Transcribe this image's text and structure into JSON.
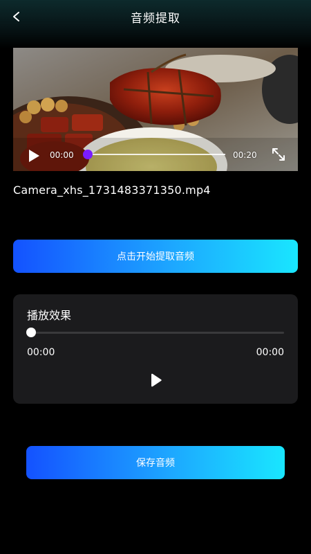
{
  "header": {
    "title": "音频提取",
    "back_icon": "chevron-left-icon"
  },
  "video": {
    "current_time": "00:00",
    "duration": "00:20",
    "progress": 0,
    "accent_color": "#7a1cff",
    "play_icon": "play-icon",
    "fullscreen_icon": "fullscreen-icon"
  },
  "file": {
    "name": "Camera_xhs_1731483371350.mp4"
  },
  "extract_button": {
    "label": "点击开始提取音频"
  },
  "effect_card": {
    "title": "播放效果",
    "current_time": "00:00",
    "duration": "00:00",
    "progress": 0,
    "play_icon": "play-icon"
  },
  "save_button": {
    "label": "保存音频"
  },
  "colors": {
    "gradient_start": "#1452ff",
    "gradient_end": "#19e6ff",
    "card_bg": "#1b1b1d",
    "background": "#000000"
  }
}
